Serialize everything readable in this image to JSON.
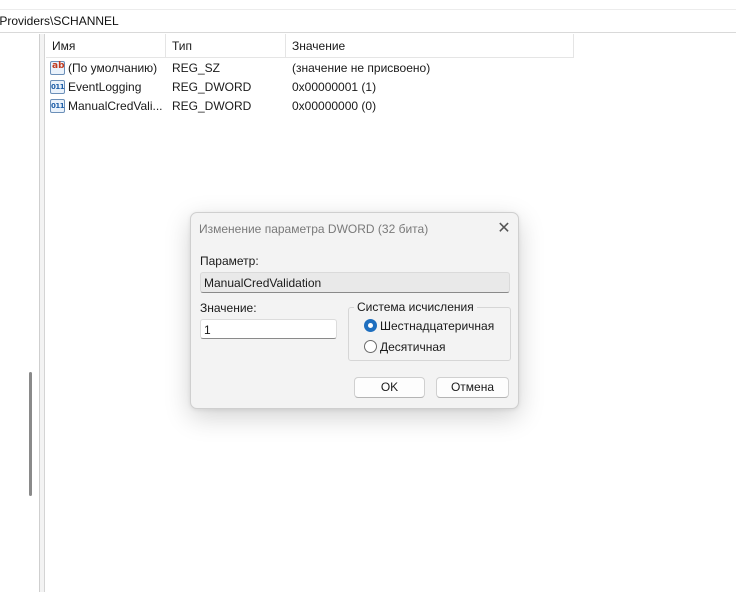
{
  "address": {
    "path": "\\Providers\\SCHANNEL"
  },
  "list": {
    "columns": {
      "name": "Имя",
      "type": "Тип",
      "value": "Значение"
    },
    "rows": [
      {
        "icon": "reg-string-icon",
        "name": "(По умолчанию)",
        "type": "REG_SZ",
        "value": "(значение не присвоено)"
      },
      {
        "icon": "reg-binary-icon",
        "name": "EventLogging",
        "type": "REG_DWORD",
        "value": "0x00000001 (1)"
      },
      {
        "icon": "reg-binary-icon",
        "name": "ManualCredVali...",
        "type": "REG_DWORD",
        "value": "0x00000000 (0)"
      }
    ]
  },
  "dialog": {
    "title": "Изменение параметра DWORD (32 бита)",
    "close_glyph": "✕",
    "param_label": "Параметр:",
    "param_value": "ManualCredValidation",
    "value_label": "Значение:",
    "value_data": "1",
    "base_group_title": "Система исчисления",
    "base_hex_label": "Шестнадцатеричная",
    "base_dec_label": "Десятичная",
    "base_selected": "hex",
    "ok_label": "OK",
    "cancel_label": "Отмена"
  },
  "colors": {
    "accent": "#1f6fbf",
    "dialog_bg": "#f3f3f3"
  }
}
